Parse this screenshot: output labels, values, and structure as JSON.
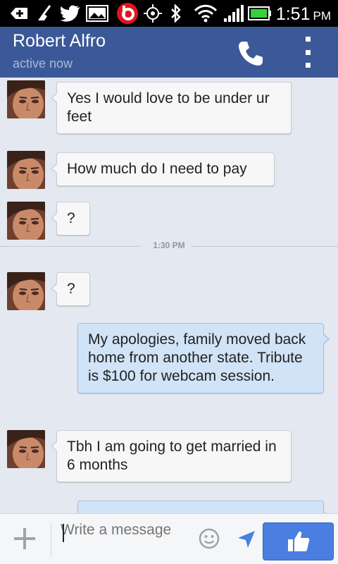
{
  "status_bar": {
    "time": "1:51",
    "ampm": "PM"
  },
  "header": {
    "contact_name": "Robert Alfro",
    "presence": "active now"
  },
  "messages": [
    {
      "direction": "in",
      "text": "Yes I would love to be under ur feet"
    },
    {
      "direction": "in",
      "text": "How much do I need to pay"
    },
    {
      "direction": "in",
      "text": "?"
    },
    {
      "direction": "in",
      "text": "?"
    },
    {
      "direction": "out",
      "text": "My apologies, family moved back home from another state. Tribute is $100 for webcam session."
    },
    {
      "direction": "in",
      "text": "Tbh I am going to get married in 6 months"
    }
  ],
  "divider": {
    "timestamp": "1:30 PM"
  },
  "compose": {
    "placeholder": "Write a message"
  },
  "colors": {
    "header_bg": "#3b5998",
    "thread_bg": "#e4e8f1",
    "incoming_bubble": "#f7f7f7",
    "outgoing_bubble": "#d1e3f7",
    "like_button": "#4a7ee0"
  }
}
